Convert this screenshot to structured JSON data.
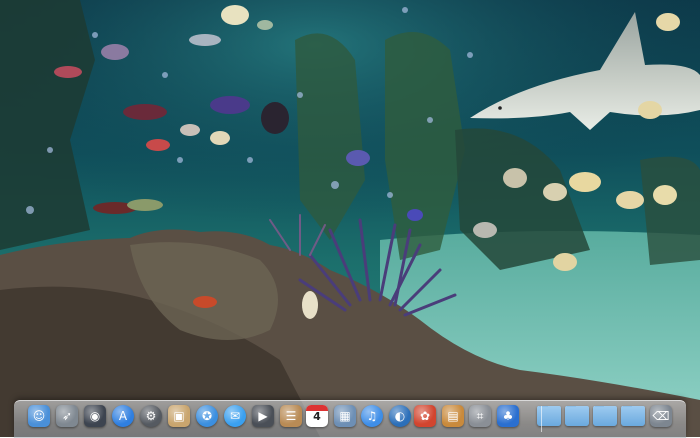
{
  "dock": {
    "items": [
      {
        "icon": "finder-icon",
        "bg": "#4a90d9"
      },
      {
        "icon": "rocket-icon",
        "bg": "#7f8891"
      },
      {
        "icon": "dashboard-icon",
        "bg": "#3d4450"
      },
      {
        "icon": "app-store-icon",
        "bg": "#2f7fe0"
      },
      {
        "icon": "system-preferences-icon",
        "bg": "#555a61"
      },
      {
        "icon": "photo-icon",
        "bg": "#c9a56e"
      },
      {
        "icon": "safari-icon",
        "bg": "#3b8fe0"
      },
      {
        "icon": "messages-icon",
        "bg": "#3aa0f0"
      },
      {
        "icon": "facetime-icon",
        "bg": "#4a4f57"
      },
      {
        "icon": "contacts-icon",
        "bg": "#b98b55"
      },
      {
        "icon": "calendar-icon",
        "bg": "#ffffff",
        "day": "4"
      },
      {
        "icon": "iphoto-icon",
        "bg": "#6d8fb5"
      },
      {
        "icon": "itunes-icon",
        "bg": "#3e8ee8"
      },
      {
        "icon": "quicktime-icon",
        "bg": "#2b6fb9"
      },
      {
        "icon": "photo-booth-icon",
        "bg": "#d2452f"
      },
      {
        "icon": "archive-icon",
        "bg": "#c98a3c"
      },
      {
        "icon": "screenshot-icon",
        "bg": "#8a8f96"
      },
      {
        "icon": "game-icon",
        "bg": "#2a6fd0"
      },
      {
        "icon": "folder-icon"
      },
      {
        "icon": "folder-icon"
      },
      {
        "icon": "folder-icon"
      },
      {
        "icon": "folder-icon"
      },
      {
        "icon": "trash-icon",
        "bg": "#7d8690"
      }
    ]
  }
}
